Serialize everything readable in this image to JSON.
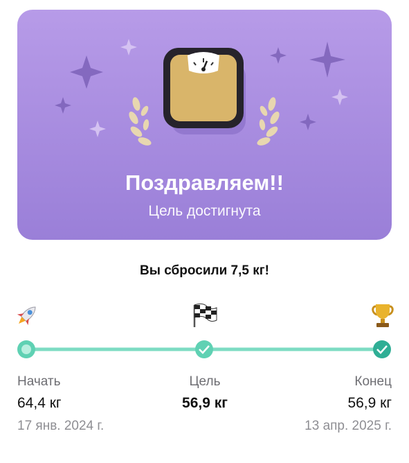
{
  "hero": {
    "title": "Поздравляем!!",
    "subtitle": "Цель достигнута",
    "icon": "bathroom-scale-icon",
    "colors": {
      "gradient_top": "#b79be8",
      "gradient_bottom": "#9a7fd8",
      "scale_body": "#d9b56a"
    }
  },
  "summary": {
    "text": "Вы сбросили 7,5 кг!"
  },
  "progress": {
    "accent_color": "#5fd1b3",
    "icons": [
      "rocket-icon",
      "checkered-flag-icon",
      "trophy-icon"
    ],
    "start": {
      "label": "Начать",
      "value": "64,4 кг",
      "date": "17 янв. 2024 г."
    },
    "goal": {
      "label": "Цель",
      "value": "56,9 кг"
    },
    "end": {
      "label": "Конец",
      "value": "56,9 кг",
      "date": "13 апр. 2025 г."
    }
  }
}
